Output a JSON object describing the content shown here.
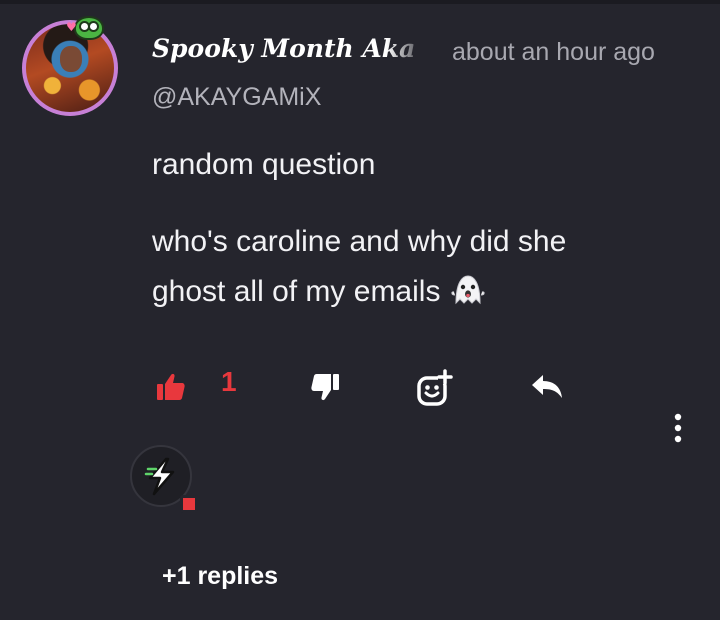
{
  "comment": {
    "author": {
      "display_name": "Spooky Month Aka",
      "handle": "@AKAYGAMiX",
      "avatar_icon": "avatar-image",
      "ring_color": "#c780d6"
    },
    "timestamp": "about an hour ago",
    "body": {
      "line1": "random question",
      "line2": "who's caroline and why did she",
      "line3": "ghost all of my emails",
      "emoji": "ghost-icon"
    },
    "actions": {
      "like_count": "1",
      "like_color": "#e8383d",
      "icons": [
        "thumbs-up-icon",
        "thumbs-down-icon",
        "add-reaction-icon",
        "reply-icon",
        "more-vertical-icon"
      ]
    },
    "badge_icon": "lightning-bolt-icon",
    "replies_label": "+1 replies"
  }
}
